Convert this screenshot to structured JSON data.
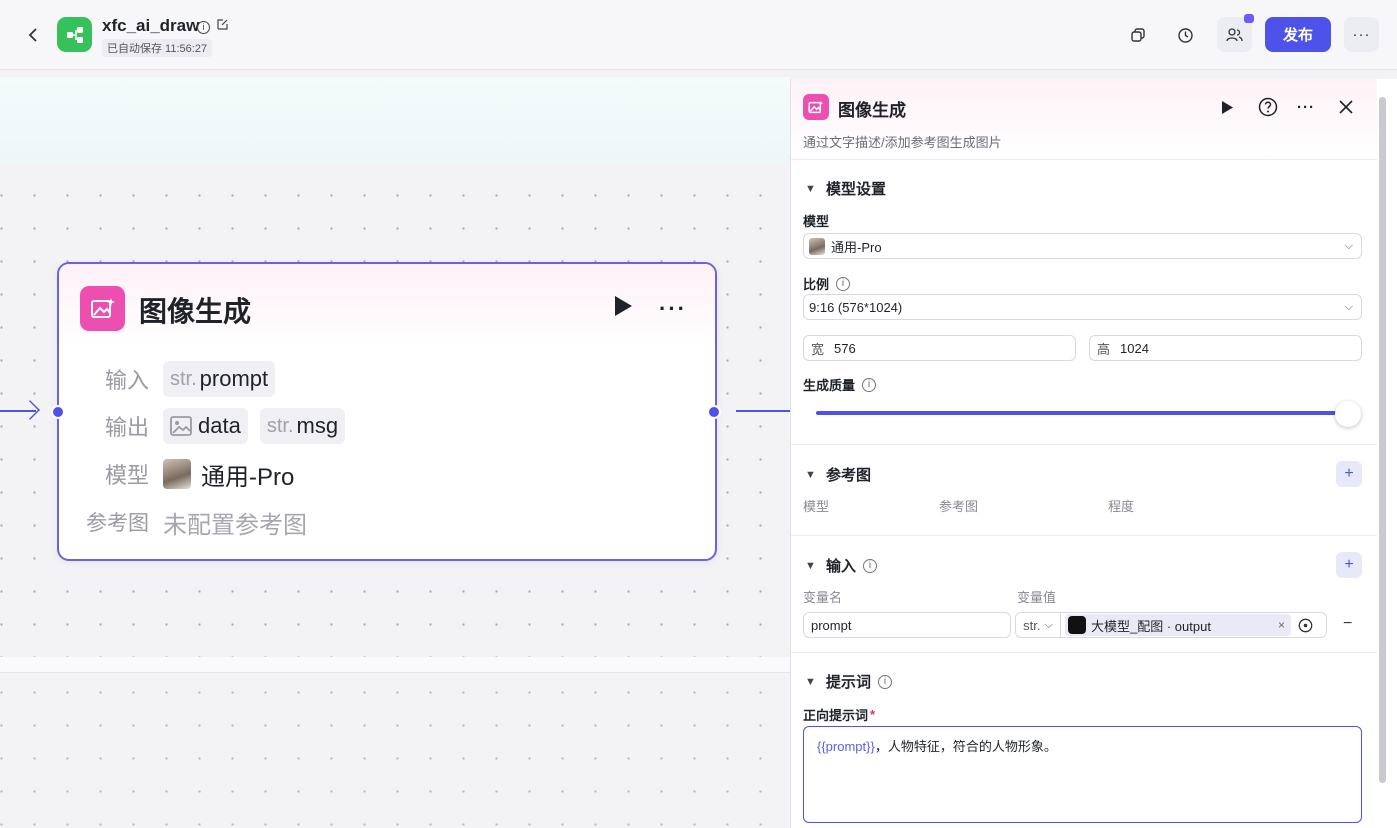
{
  "header": {
    "app_title": "xfc_ai_draw",
    "autosave": "已自动保存 11:56:27",
    "publish_label": "发布",
    "more_label": "···"
  },
  "node": {
    "title": "图像生成",
    "more_label": "···",
    "input_label": "输入",
    "input_type": "str.",
    "input_name": "prompt",
    "output_label": "输出",
    "output_1": "data",
    "output_2_type": "str.",
    "output_2": "msg",
    "model_label": "模型",
    "model_value": "通用-Pro",
    "ref_label": "参考图",
    "ref_value": "未配置参考图"
  },
  "panel": {
    "title": "图像生成",
    "description": "通过文字描述/添加参考图生成图片",
    "model_settings": {
      "title": "模型设置",
      "model_label": "模型",
      "model_value": "通用-Pro",
      "ratio_label": "比例",
      "ratio_value": "9:16 (576*1024)",
      "width_prefix": "宽",
      "width_value": "576",
      "height_prefix": "高",
      "height_value": "1024",
      "quality_label": "生成质量",
      "quality_level": 1.0
    },
    "reference": {
      "title": "参考图",
      "col_model": "模型",
      "col_image": "参考图",
      "col_degree": "程度"
    },
    "inputs": {
      "title": "输入",
      "col_name": "变量名",
      "col_value": "变量值",
      "row_name": "prompt",
      "row_type": "str.",
      "row_ref": "大模型_配图 · output"
    },
    "prompt": {
      "title": "提示词",
      "positive_label": "正向提示词",
      "required_mark": "*",
      "var_text": "{{prompt}}",
      "rest_text": "，人物特征，符合的人物形象。"
    }
  },
  "colors": {
    "accent": "#4d53e8",
    "node_icon": "#ec4fb0",
    "app_logo": "#36c15a"
  }
}
